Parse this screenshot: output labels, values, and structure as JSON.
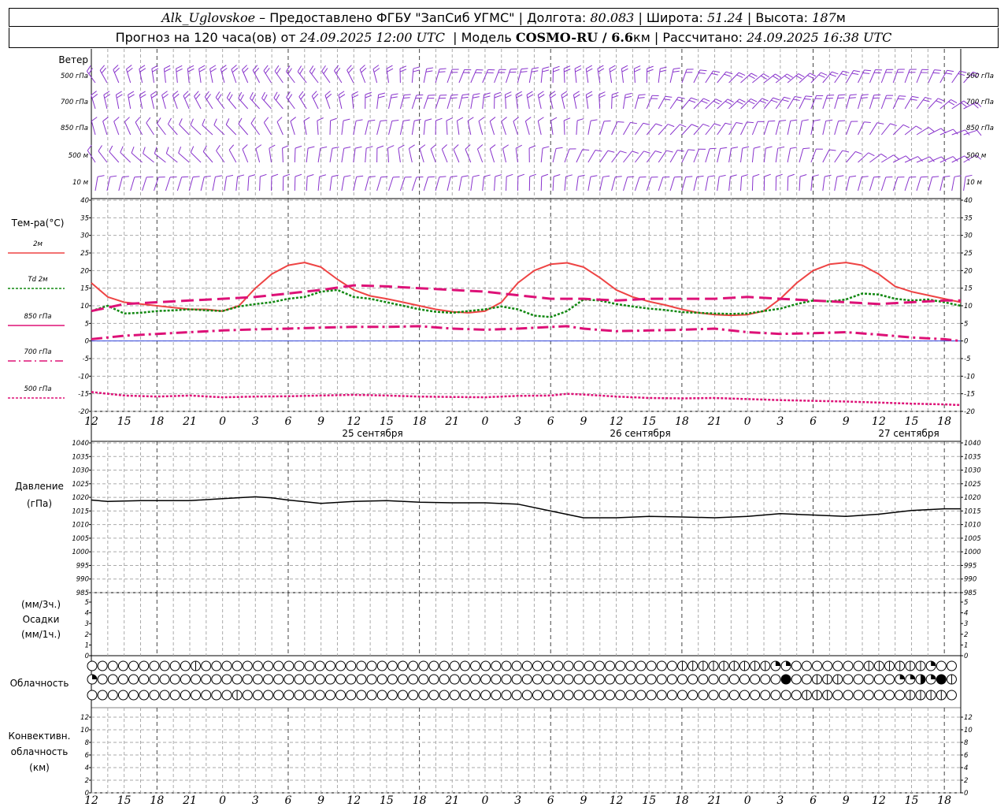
{
  "header": {
    "station": "Alk_Uglovskoe",
    "provider": "Предоставлено ФГБУ \"ЗапСиб УГМС\"",
    "lon_label": "Долгота:",
    "lon": "80.083",
    "lat_label": "Широта:",
    "lat": "51.24",
    "alt_label": "Высота:",
    "alt": "187",
    "alt_unit": "м",
    "forecast_prefix": "Прогноз на 120 часа(ов) от",
    "forecast_time": "24.09.2025 12:00 UTC",
    "model_label": "Модель",
    "model": "COSMO-RU / 6.6",
    "model_unit": "км",
    "calc_label": "Рассчитано:",
    "calc_time": "24.09.2025 16:38 UTC"
  },
  "wind": {
    "title": "Ветер",
    "levels": [
      "500 гПа",
      "700 гПа",
      "850 гПа",
      "500 м",
      "10 м"
    ]
  },
  "temp": {
    "title": "Тем-ра(°C)",
    "legend": [
      {
        "label": "2м",
        "color": "#ee4444",
        "style": "solid"
      },
      {
        "label": "2м",
        "prefix": "Td",
        "color": "#118811",
        "style": "dotted"
      },
      {
        "label": "850 гПа",
        "color": "#dd1177",
        "style": "solid"
      },
      {
        "label": "700 гПа",
        "color": "#dd1177",
        "style": "dashdot"
      },
      {
        "label": "500 гПа",
        "color": "#dd1177",
        "style": "dotted"
      }
    ]
  },
  "pressure": {
    "title": "Давление",
    "unit": "(гПа)"
  },
  "precip": {
    "unit3": "(мм/3ч.)",
    "title": "Осадки",
    "unit1": "(мм/1ч.)"
  },
  "clouds": {
    "title": "Облачность"
  },
  "convective": {
    "line1": "Конвективн.",
    "line2": "облачность",
    "unit": "(км)"
  },
  "x_ticks": [
    "12",
    "15",
    "18",
    "21",
    "0",
    "3",
    "6",
    "9",
    "12",
    "15",
    "18",
    "21",
    "0",
    "3",
    "6",
    "9",
    "12",
    "15",
    "18",
    "21",
    "0",
    "3",
    "6",
    "9",
    "12",
    "15",
    "18"
  ],
  "dates": [
    "25 сентября",
    "26 сентября",
    "27 сентября"
  ],
  "chart_data": [
    {
      "type": "line",
      "title": "Тем-ра(°C)",
      "x_hours": [
        0,
        3,
        6,
        9,
        12,
        15,
        18,
        21,
        24,
        27,
        30,
        33,
        36,
        39,
        42,
        45,
        48,
        51,
        54,
        57,
        60,
        63,
        66,
        69,
        72,
        75,
        78,
        81,
        84,
        87,
        90,
        93,
        96,
        99,
        102,
        105,
        108,
        111,
        114,
        117,
        120,
        123,
        126,
        129,
        132,
        135,
        138,
        141,
        144,
        147,
        150,
        153,
        156,
        159,
        162,
        165,
        168,
        171,
        174,
        177,
        180,
        183,
        186,
        189,
        192,
        195,
        198,
        201,
        204,
        207,
        210,
        213,
        216,
        219,
        222,
        225,
        228,
        231,
        234
      ],
      "ylim": [
        -20,
        40
      ],
      "series": [
        {
          "name": "2м",
          "points": [
            [
              0,
              16.5
            ],
            [
              3,
              12.5
            ],
            [
              6,
              11
            ],
            [
              9,
              10.5
            ],
            [
              12,
              10
            ],
            [
              15,
              9.5
            ],
            [
              18,
              9
            ],
            [
              21,
              9
            ],
            [
              24,
              8.5
            ],
            [
              27,
              10
            ],
            [
              30,
              15
            ],
            [
              33,
              19
            ],
            [
              36,
              21.5
            ],
            [
              39,
              22.3
            ],
            [
              42,
              21
            ],
            [
              45,
              17.5
            ],
            [
              48,
              14.5
            ],
            [
              51,
              12.8
            ],
            [
              54,
              12
            ],
            [
              57,
              11
            ],
            [
              60,
              10
            ],
            [
              63,
              9
            ],
            [
              66,
              8.3
            ],
            [
              69,
              8
            ],
            [
              72,
              8.5
            ],
            [
              75,
              11
            ],
            [
              78,
              16.5
            ],
            [
              81,
              20
            ],
            [
              84,
              21.8
            ],
            [
              87,
              22.2
            ],
            [
              90,
              21
            ],
            [
              93,
              18
            ],
            [
              96,
              14.5
            ],
            [
              99,
              12.5
            ],
            [
              102,
              11.2
            ],
            [
              105,
              10.2
            ],
            [
              108,
              9
            ],
            [
              111,
              8
            ],
            [
              114,
              7.5
            ],
            [
              117,
              7.3
            ],
            [
              120,
              7.5
            ],
            [
              123,
              8.5
            ],
            [
              126,
              12
            ],
            [
              129,
              16.5
            ],
            [
              132,
              20
            ],
            [
              135,
              21.8
            ],
            [
              138,
              22.3
            ],
            [
              141,
              21.5
            ],
            [
              144,
              19
            ],
            [
              147,
              15.5
            ],
            [
              150,
              14
            ],
            [
              153,
              13
            ],
            [
              156,
              12
            ],
            [
              159,
              11
            ]
          ]
        },
        {
          "name": "Td 2м",
          "points": [
            [
              0,
              8.5
            ],
            [
              3,
              10
            ],
            [
              6,
              7.8
            ],
            [
              9,
              8
            ],
            [
              12,
              8.5
            ],
            [
              15,
              8.7
            ],
            [
              18,
              9
            ],
            [
              21,
              8.7
            ],
            [
              24,
              8.5
            ],
            [
              27,
              9.8
            ],
            [
              30,
              10.5
            ],
            [
              33,
              11
            ],
            [
              36,
              12
            ],
            [
              39,
              12.5
            ],
            [
              42,
              14
            ],
            [
              45,
              14.5
            ],
            [
              48,
              12.5
            ],
            [
              51,
              12
            ],
            [
              54,
              11
            ],
            [
              57,
              10
            ],
            [
              60,
              9
            ],
            [
              63,
              8.3
            ],
            [
              66,
              8
            ],
            [
              69,
              8.5
            ],
            [
              72,
              9
            ],
            [
              75,
              9.8
            ],
            [
              78,
              9
            ],
            [
              81,
              7.2
            ],
            [
              84,
              6.8
            ],
            [
              87,
              8.5
            ],
            [
              90,
              11.8
            ],
            [
              93,
              11.5
            ],
            [
              96,
              10.5
            ],
            [
              99,
              9.8
            ],
            [
              102,
              9.2
            ],
            [
              105,
              8.8
            ],
            [
              108,
              8.2
            ],
            [
              111,
              8
            ],
            [
              114,
              7.8
            ],
            [
              117,
              7.7
            ],
            [
              120,
              7.8
            ],
            [
              123,
              8.5
            ],
            [
              126,
              9.2
            ],
            [
              129,
              10.5
            ],
            [
              132,
              11.5
            ],
            [
              135,
              11.2
            ],
            [
              138,
              11.8
            ],
            [
              141,
              13.5
            ],
            [
              144,
              13.2
            ],
            [
              147,
              12
            ],
            [
              150,
              11.5
            ],
            [
              153,
              11.8
            ],
            [
              156,
              11
            ],
            [
              159,
              10
            ]
          ]
        },
        {
          "name": "850 гПа",
          "points": [
            [
              0,
              8.5
            ],
            [
              6,
              10.5
            ],
            [
              12,
              11
            ],
            [
              18,
              11.5
            ],
            [
              24,
              12
            ],
            [
              30,
              12.5
            ],
            [
              36,
              13.5
            ],
            [
              42,
              14.5
            ],
            [
              48,
              15.8
            ],
            [
              54,
              15.5
            ],
            [
              60,
              15
            ],
            [
              66,
              14.5
            ],
            [
              72,
              14
            ],
            [
              78,
              13
            ],
            [
              84,
              12
            ],
            [
              90,
              12
            ],
            [
              96,
              11.5
            ],
            [
              102,
              12
            ],
            [
              108,
              12
            ],
            [
              114,
              12
            ],
            [
              120,
              12.5
            ],
            [
              126,
              12
            ],
            [
              132,
              11.5
            ],
            [
              138,
              11
            ],
            [
              144,
              10.5
            ],
            [
              150,
              11
            ],
            [
              156,
              11.5
            ],
            [
              159,
              11.5
            ]
          ]
        },
        {
          "name": "700 гПа",
          "points": [
            [
              0,
              0.5
            ],
            [
              6,
              1.5
            ],
            [
              12,
              2
            ],
            [
              18,
              2.5
            ],
            [
              24,
              3
            ],
            [
              30,
              3.3
            ],
            [
              36,
              3.5
            ],
            [
              42,
              3.8
            ],
            [
              48,
              4
            ],
            [
              54,
              4
            ],
            [
              60,
              4.2
            ],
            [
              66,
              3.5
            ],
            [
              72,
              3.2
            ],
            [
              78,
              3.5
            ],
            [
              84,
              4
            ],
            [
              87,
              4.2
            ],
            [
              90,
              3.5
            ],
            [
              96,
              2.8
            ],
            [
              102,
              3
            ],
            [
              108,
              3.2
            ],
            [
              114,
              3.5
            ],
            [
              120,
              2.5
            ],
            [
              126,
              2
            ],
            [
              132,
              2.2
            ],
            [
              138,
              2.5
            ],
            [
              144,
              1.8
            ],
            [
              150,
              1
            ],
            [
              156,
              0.5
            ],
            [
              159,
              0
            ]
          ]
        },
        {
          "name": "500 гПа",
          "points": [
            [
              0,
              -14.5
            ],
            [
              6,
              -15.5
            ],
            [
              12,
              -15.8
            ],
            [
              18,
              -15.5
            ],
            [
              24,
              -16
            ],
            [
              30,
              -15.8
            ],
            [
              36,
              -15.7
            ],
            [
              42,
              -15.5
            ],
            [
              48,
              -15.3
            ],
            [
              54,
              -15.5
            ],
            [
              60,
              -15.8
            ],
            [
              66,
              -15.9
            ],
            [
              72,
              -16
            ],
            [
              78,
              -15.6
            ],
            [
              84,
              -15.5
            ],
            [
              87,
              -15
            ],
            [
              90,
              -15.2
            ],
            [
              96,
              -15.8
            ],
            [
              102,
              -16.2
            ],
            [
              108,
              -16.3
            ],
            [
              114,
              -16.2
            ],
            [
              120,
              -16.5
            ],
            [
              126,
              -16.8
            ],
            [
              132,
              -17
            ],
            [
              138,
              -17.2
            ],
            [
              144,
              -17.5
            ],
            [
              150,
              -17.8
            ],
            [
              156,
              -18
            ],
            [
              159,
              -18.2
            ]
          ]
        }
      ],
      "y_ticks": [
        -20,
        -15,
        -10,
        -5,
        0,
        5,
        10,
        15,
        20,
        25,
        30,
        35,
        40
      ]
    },
    {
      "type": "line",
      "title": "Давление",
      "ylabel": "(гПа)",
      "ylim": [
        985,
        1040
      ],
      "y_ticks": [
        985,
        990,
        995,
        1000,
        1005,
        1010,
        1015,
        1020,
        1025,
        1030,
        1035,
        1040
      ],
      "series": [
        {
          "name": "Давление",
          "points": [
            [
              0,
              1019
            ],
            [
              3,
              1018.5
            ],
            [
              9,
              1018.8
            ],
            [
              18,
              1018.8
            ],
            [
              24,
              1019.5
            ],
            [
              30,
              1020.2
            ],
            [
              33,
              1019.8
            ],
            [
              36,
              1019
            ],
            [
              42,
              1017.8
            ],
            [
              48,
              1018.5
            ],
            [
              54,
              1018.8
            ],
            [
              60,
              1018.2
            ],
            [
              66,
              1018
            ],
            [
              72,
              1018
            ],
            [
              78,
              1017.5
            ],
            [
              84,
              1015
            ],
            [
              90,
              1012.5
            ],
            [
              96,
              1012.5
            ],
            [
              102,
              1013
            ],
            [
              108,
              1012.8
            ],
            [
              114,
              1012.5
            ],
            [
              120,
              1013
            ],
            [
              126,
              1014
            ],
            [
              132,
              1013.5
            ],
            [
              138,
              1013
            ],
            [
              144,
              1013.8
            ],
            [
              150,
              1015.2
            ],
            [
              156,
              1015.8
            ],
            [
              159,
              1015.8
            ]
          ]
        }
      ]
    },
    {
      "type": "bar",
      "title": "Осадки",
      "ylim": [
        0,
        5
      ],
      "y_ticks": [
        0,
        1,
        2,
        3,
        4,
        5
      ],
      "values": []
    },
    {
      "type": "line",
      "title": "Конвективн. облачность",
      "ylim": [
        0,
        13
      ],
      "y_ticks": [
        0,
        2,
        4,
        6,
        8,
        10,
        12
      ],
      "values": []
    }
  ],
  "cloud_rows": [
    {
      "name": "row-upper",
      "fills": "000000000010000000000000000000000000000000000000000000000111111111230000000111111300"
    },
    {
      "name": "row-middle",
      "fills": "300000000000000000000000000000000000000000000000000000000000000000040011100000336341"
    },
    {
      "name": "row-lower",
      "fills": "000000000000001000000000000000000000000000000000000000000000000000000111000000011110"
    }
  ],
  "colors": {
    "wind": "#8833cc",
    "t2m": "#ee4444",
    "td": "#118811",
    "levels": "#dd1177",
    "pressure": "#000000",
    "zero_line": "#3344dd"
  }
}
